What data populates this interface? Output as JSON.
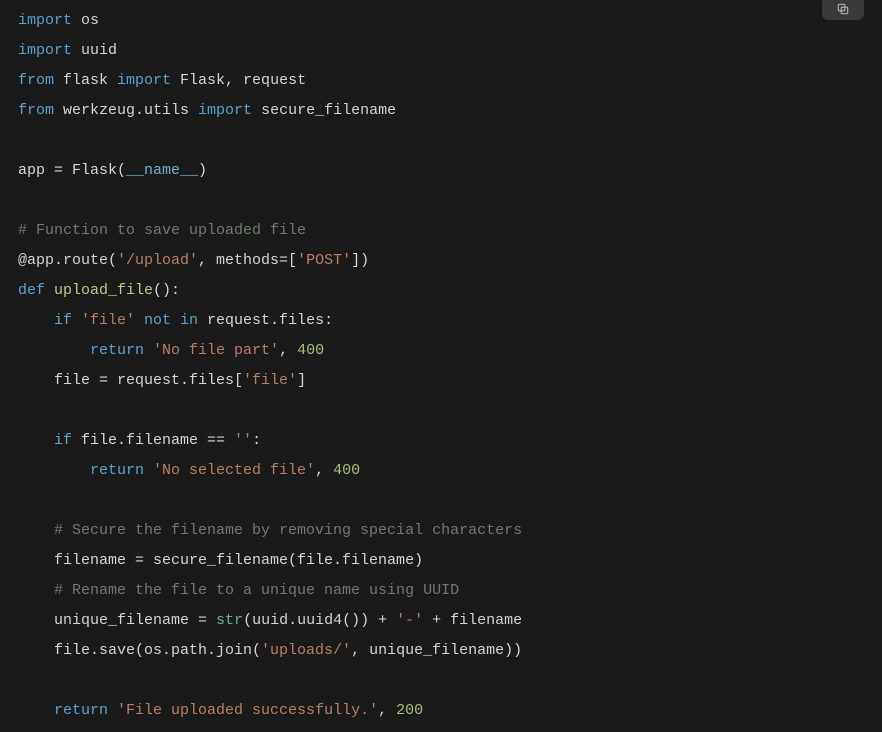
{
  "copy_label": "Copy",
  "code": {
    "l1": {
      "kw1": "import",
      "sp": " ",
      "m": "os"
    },
    "l2": {
      "kw1": "import",
      "sp": " ",
      "m": "uuid"
    },
    "l3": {
      "kw1": "from",
      "m1": " flask ",
      "kw2": "import",
      "m2": " Flask, request"
    },
    "l4": {
      "kw1": "from",
      "m1": " werkzeug.utils ",
      "kw2": "import",
      "m2": " secure_filename"
    },
    "l6": "app = Flask(__name__)",
    "l8": "# Function to save uploaded file",
    "l9a": "@app",
    "l9b": ".route(",
    "l9s": "'/upload'",
    "l9c": ", methods=[",
    "l9s2": "'POST'",
    "l9d": "])",
    "l10a": "def ",
    "l10b": "upload_file",
    "l10c": "():",
    "l11a": "    if ",
    "l11s": "'file'",
    "l11b": " not in ",
    "l11c": "request.files:",
    "l12a": "        return ",
    "l12s": "'No file part'",
    "l12b": ", ",
    "l12n": "400",
    "l13a": "    file = request.files[",
    "l13s": "'file'",
    "l13b": "]",
    "l15a": "    if ",
    "l15b": "file.filename == ",
    "l15s": "''",
    "l15c": ":",
    "l16a": "        return ",
    "l16s": "'No selected file'",
    "l16b": ", ",
    "l16n": "400",
    "l18": "    # Secure the filename by removing special characters",
    "l19": "    filename = secure_filename(file.filename)",
    "l20": "    # Rename the file to a unique name using UUID",
    "l21a": "    unique_filename = ",
    "l21b": "str",
    "l21c": "(uuid.uuid4()) + ",
    "l21s": "'-'",
    "l21d": " + filename",
    "l22a": "    file.save(os.path.join(",
    "l22s": "'uploads/'",
    "l22b": ", unique_filename))",
    "l24a": "    return ",
    "l24s": "'File uploaded successfully.'",
    "l24b": ", ",
    "l24n": "200"
  }
}
